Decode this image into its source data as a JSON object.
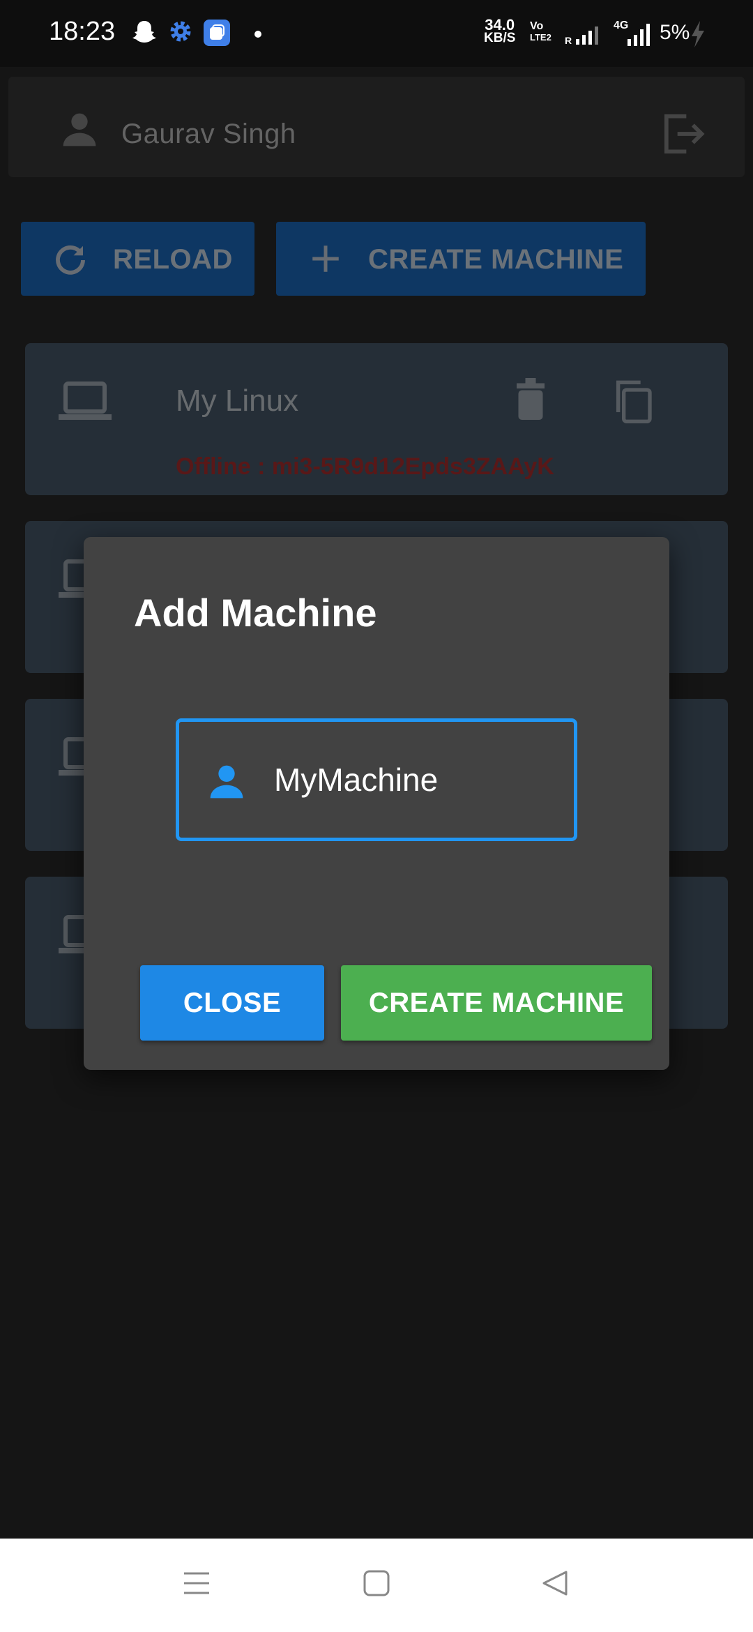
{
  "status_bar": {
    "time": "18:23",
    "net_speed_value": "34.0",
    "net_speed_unit": "KB/S",
    "volte_top": "Vo",
    "volte_bottom": "LTE2",
    "roaming": "R",
    "network_type": "4G",
    "battery": "5%"
  },
  "header": {
    "user_name": "Gaurav Singh"
  },
  "toolbar": {
    "reload_label": "RELOAD",
    "create_label": "CREATE MACHINE"
  },
  "machines": [
    {
      "name": "My Linux",
      "status": "Offline : mi3-5R9d12Epds3ZAAyK"
    },
    {
      "name": "",
      "status": ""
    },
    {
      "name": "",
      "status": ""
    },
    {
      "name": "",
      "status": ""
    }
  ],
  "modal": {
    "title": "Add Machine",
    "field_value": "MyMachine",
    "close_label": "CLOSE",
    "create_label": "CREATE MACHINE"
  },
  "colors": {
    "accent_blue": "#1e88e5",
    "create_green": "#4caf50",
    "card_bg": "#4b5d6f",
    "status_offline": "#b23030"
  }
}
